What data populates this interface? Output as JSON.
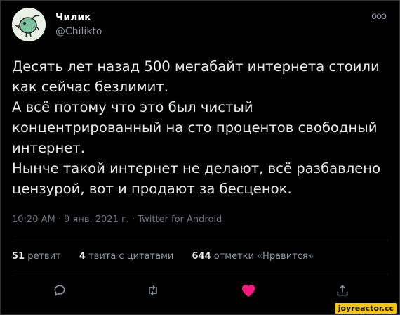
{
  "author": {
    "name": "Чилик",
    "handle": "@Chilikto"
  },
  "menu_icon": "more-dots-icon",
  "tweet": {
    "text": "Десять лет назад 500 мегабайт интернета стоили\nкак сейчас безлимит.\nА всё потому что это был чистый\nконцентрированный на сто процентов свободный\nинтернет.\nНынче такой интернет не делают, всё разбавлено\nцензурой, вот и продают за бесценок.",
    "meta": "10:20 AM · 9 янв. 2021 г. · Twitter for Android"
  },
  "stats": {
    "retweets_count": "51",
    "retweets_label": "ретвит",
    "quotes_count": "4",
    "quotes_label": "твита с цитатами",
    "likes_count": "644",
    "likes_label": "отметки «Нравится»"
  },
  "actions": [
    "reply-icon",
    "retweet-icon",
    "like-icon",
    "share-icon"
  ],
  "colors": {
    "background": "#000000",
    "like": "#f91880",
    "muted": "#8b98a5"
  },
  "watermark": "joyreactor.cc"
}
